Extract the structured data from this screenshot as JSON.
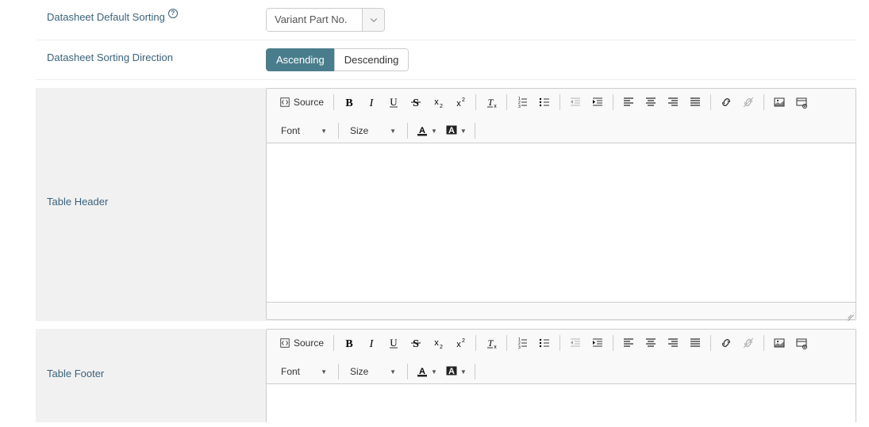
{
  "fields": {
    "default_sorting": {
      "label": "Datasheet Default Sorting",
      "value": "Variant Part No.",
      "has_help": true
    },
    "sorting_direction": {
      "label": "Datasheet Sorting Direction",
      "options": {
        "asc": "Ascending",
        "desc": "Descending"
      },
      "active": "asc"
    },
    "table_header": {
      "label": "Table Header"
    },
    "table_footer": {
      "label": "Table Footer"
    }
  },
  "editor": {
    "source": "Source",
    "font_label": "Font",
    "size_label": "Size"
  },
  "icons": {
    "help": "?"
  }
}
